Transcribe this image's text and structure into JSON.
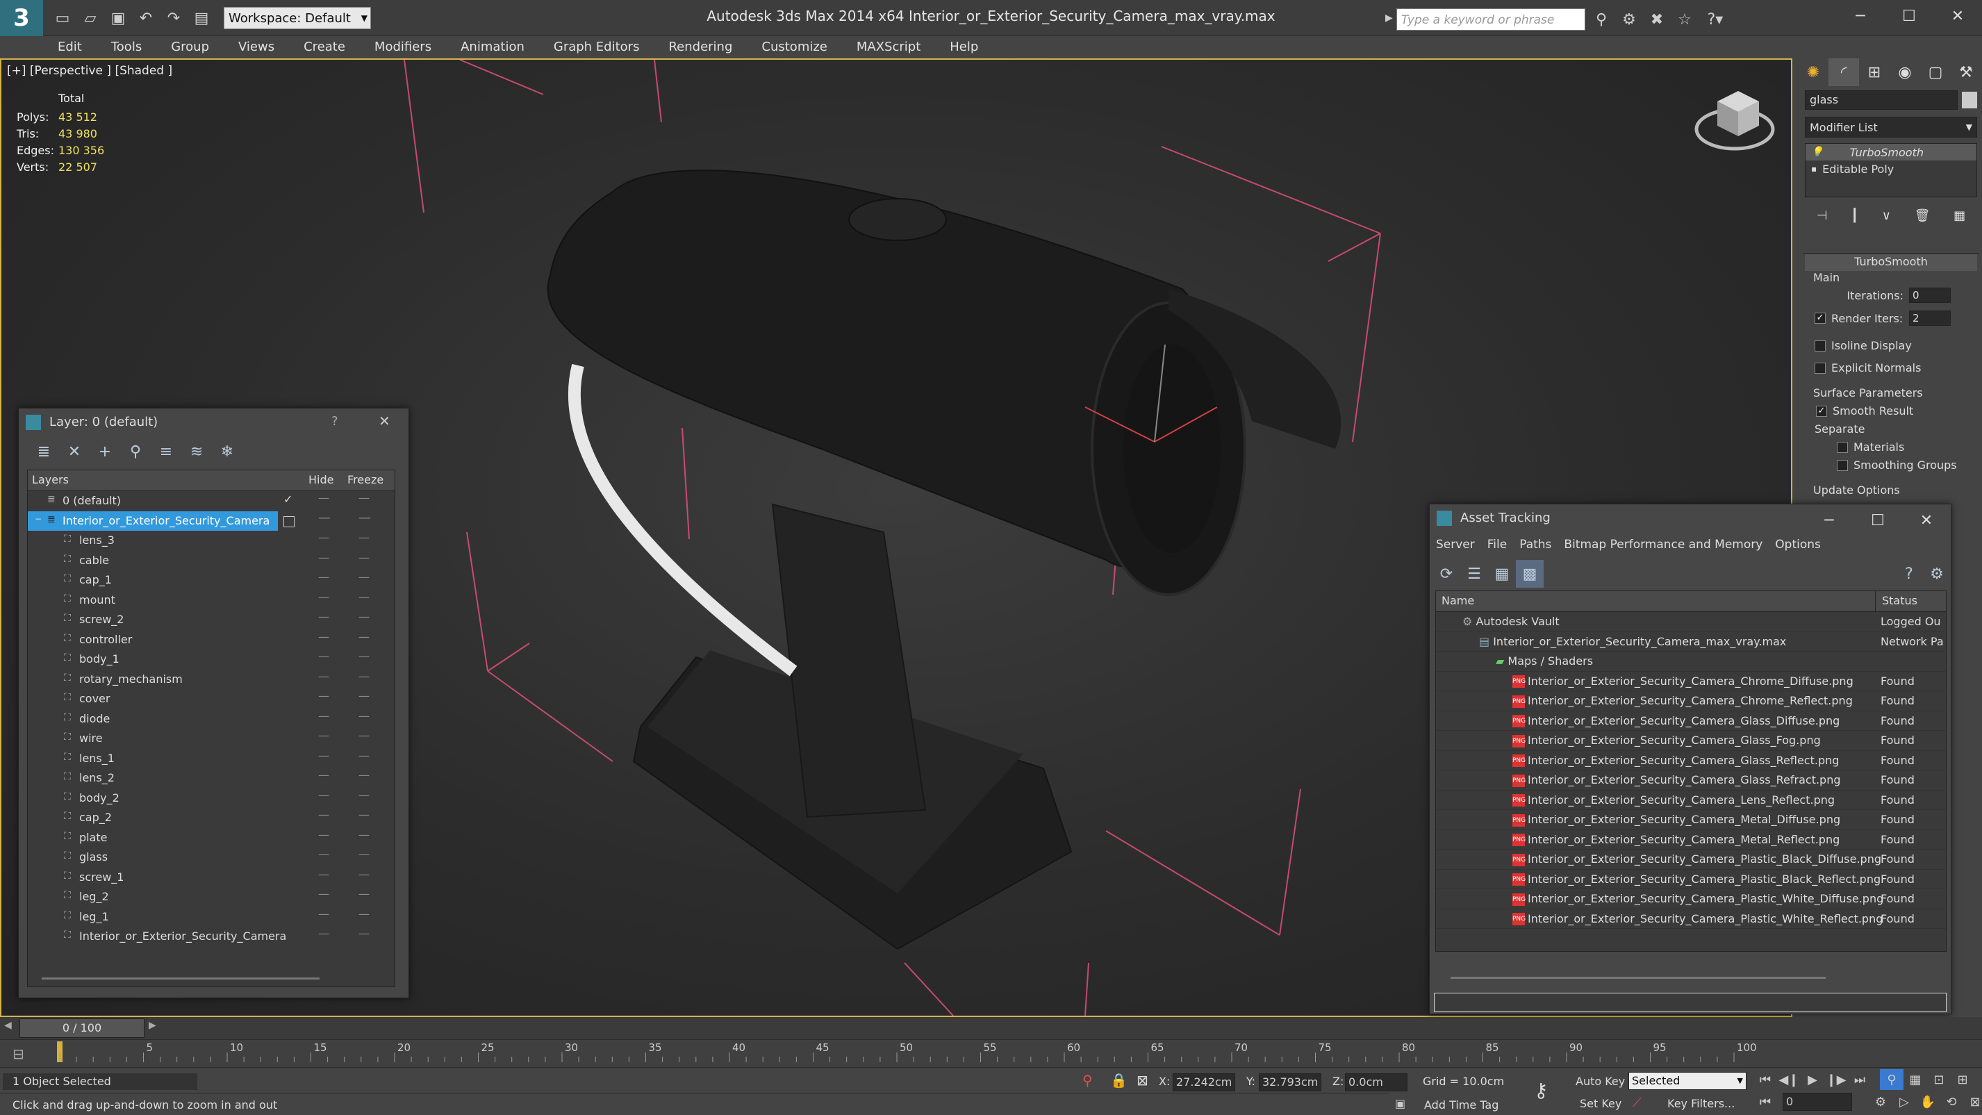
{
  "app": {
    "title": "Autodesk 3ds Max  2014 x64      Interior_or_Exterior_Security_Camera_max_vray.max",
    "workspace": "Workspace: Default",
    "search_placeholder": "Type a keyword or phrase"
  },
  "menu": [
    "Edit",
    "Tools",
    "Group",
    "Views",
    "Create",
    "Modifiers",
    "Animation",
    "Graph Editors",
    "Rendering",
    "Customize",
    "MAXScript",
    "Help"
  ],
  "viewport": {
    "label": "[+] [Perspective ] [Shaded ]",
    "stats": {
      "total_label": "Total",
      "rows": [
        {
          "label": "Polys:",
          "value": "43 512"
        },
        {
          "label": "Tris:",
          "value": "43 980"
        },
        {
          "label": "Edges:",
          "value": "130 356"
        },
        {
          "label": "Verts:",
          "value": "22 507"
        }
      ]
    }
  },
  "command_panel": {
    "object_name": "glass",
    "modifier_list": "Modifier List",
    "stack": [
      "TurboSmooth",
      "Editable Poly"
    ],
    "rollout_title": "TurboSmooth",
    "main_label": "Main",
    "iterations_label": "Iterations:",
    "iterations_value": "0",
    "render_iters_label": "Render Iters:",
    "render_iters_value": "2",
    "isoline": "Isoline Display",
    "explicit_normals": "Explicit Normals",
    "surface_params": "Surface Parameters",
    "smooth_result": "Smooth Result",
    "separate": "Separate",
    "materials": "Materials",
    "smoothing_groups": "Smoothing Groups",
    "update_options": "Update Options"
  },
  "layer_window": {
    "title": "Layer: 0 (default)",
    "help": "?",
    "close": "✕",
    "col_layers": "Layers",
    "col_hide": "Hide",
    "col_freeze": "Freeze",
    "default_layer": "0 (default)",
    "camera_layer": "Interior_or_Exterior_Security_Camera",
    "objects": [
      "lens_3",
      "cable",
      "cap_1",
      "mount",
      "screw_2",
      "controller",
      "body_1",
      "rotary_mechanism",
      "cover",
      "diode",
      "wire",
      "lens_1",
      "lens_2",
      "body_2",
      "cap_2",
      "plate",
      "glass",
      "screw_1",
      "leg_2",
      "leg_1",
      "Interior_or_Exterior_Security_Camera"
    ]
  },
  "asset_window": {
    "title": "Asset Tracking",
    "menu": [
      "Server",
      "File",
      "Paths",
      "Bitmap Performance and Memory",
      "Options"
    ],
    "col_name": "Name",
    "col_status": "Status",
    "vault": {
      "name": "Autodesk Vault",
      "status": "Logged Ou"
    },
    "file": {
      "name": "Interior_or_Exterior_Security_Camera_max_vray.max",
      "status": "Network Pa"
    },
    "maps_folder": "Maps / Shaders",
    "maps": [
      {
        "name": "Interior_or_Exterior_Security_Camera_Chrome_Diffuse.png",
        "status": "Found"
      },
      {
        "name": "Interior_or_Exterior_Security_Camera_Chrome_Reflect.png",
        "status": "Found"
      },
      {
        "name": "Interior_or_Exterior_Security_Camera_Glass_Diffuse.png",
        "status": "Found"
      },
      {
        "name": "Interior_or_Exterior_Security_Camera_Glass_Fog.png",
        "status": "Found"
      },
      {
        "name": "Interior_or_Exterior_Security_Camera_Glass_Reflect.png",
        "status": "Found"
      },
      {
        "name": "Interior_or_Exterior_Security_Camera_Glass_Refract.png",
        "status": "Found"
      },
      {
        "name": "Interior_or_Exterior_Security_Camera_Lens_Reflect.png",
        "status": "Found"
      },
      {
        "name": "Interior_or_Exterior_Security_Camera_Metal_Diffuse.png",
        "status": "Found"
      },
      {
        "name": "Interior_or_Exterior_Security_Camera_Metal_Reflect.png",
        "status": "Found"
      },
      {
        "name": "Interior_or_Exterior_Security_Camera_Plastic_Black_Diffuse.png",
        "status": "Found"
      },
      {
        "name": "Interior_or_Exterior_Security_Camera_Plastic_Black_Reflect.png",
        "status": "Found"
      },
      {
        "name": "Interior_or_Exterior_Security_Camera_Plastic_White_Diffuse.png",
        "status": "Found"
      },
      {
        "name": "Interior_or_Exterior_Security_Camera_Plastic_White_Reflect.png",
        "status": "Found"
      }
    ]
  },
  "timeline": {
    "frame": "0 / 100",
    "ticks": [
      "5",
      "10",
      "15",
      "20",
      "25",
      "30",
      "35",
      "40",
      "45",
      "50",
      "55",
      "60",
      "65",
      "70",
      "75",
      "80",
      "85",
      "90",
      "95",
      "100"
    ]
  },
  "status": {
    "selection": "1 Object Selected",
    "prompt": "Click and drag up-and-down to zoom in and out",
    "x_label": "X:",
    "x_value": "27.242cm",
    "y_label": "Y:",
    "y_value": "32.793cm",
    "z_label": "Z:",
    "z_value": "0.0cm",
    "grid": "Grid = 10.0cm",
    "add_time_tag": "Add Time Tag",
    "auto_key": "Auto Key",
    "set_key": "Set Key",
    "selected": "Selected",
    "key_filters": "Key Filters...",
    "frame_value": "0"
  }
}
